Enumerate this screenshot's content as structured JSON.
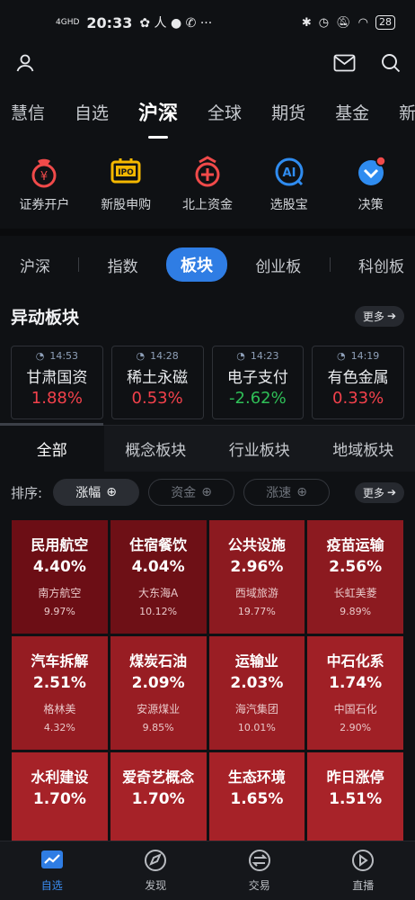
{
  "status_bar": {
    "network": "4GHD",
    "time": "20:33",
    "battery": "28"
  },
  "main_tabs": [
    "慧信",
    "自选",
    "沪深",
    "全球",
    "期货",
    "基金",
    "新三板"
  ],
  "quick": [
    {
      "label": "证券开户",
      "icon": "account-open-icon"
    },
    {
      "label": "新股申购",
      "icon": "ipo-icon"
    },
    {
      "label": "北上资金",
      "icon": "northbound-icon"
    },
    {
      "label": "选股宝",
      "icon": "ai-picker-icon"
    },
    {
      "label": "决策",
      "icon": "decision-icon"
    }
  ],
  "segments": [
    "沪深",
    "指数",
    "板块",
    "创业板",
    "科创板"
  ],
  "abnormal": {
    "title": "异动板块",
    "more": "更多",
    "cards": [
      {
        "time": "14:53",
        "name": "甘肃国资",
        "pct": "1.88%",
        "dir": "up"
      },
      {
        "time": "14:28",
        "name": "稀土永磁",
        "pct": "0.53%",
        "dir": "up"
      },
      {
        "time": "14:23",
        "name": "电子支付",
        "pct": "-2.62%",
        "dir": "down"
      },
      {
        "time": "14:19",
        "name": "有色金属",
        "pct": "0.33%",
        "dir": "up"
      }
    ]
  },
  "sub_tabs": [
    "全部",
    "概念板块",
    "行业板块",
    "地域板块"
  ],
  "sort": {
    "label": "排序:",
    "options": [
      "涨幅",
      "资金",
      "涨速"
    ],
    "more": "更多"
  },
  "tiles": [
    {
      "name": "民用航空",
      "pct": "4.40%",
      "stock": "南方航空",
      "stock_pct": "9.97%",
      "color": "#6c0e15"
    },
    {
      "name": "住宿餐饮",
      "pct": "4.04%",
      "stock": "大东海A",
      "stock_pct": "10.12%",
      "color": "#6e1016"
    },
    {
      "name": "公共设施",
      "pct": "2.96%",
      "stock": "西域旅游",
      "stock_pct": "19.77%",
      "color": "#8c1a20"
    },
    {
      "name": "疫苗运输",
      "pct": "2.56%",
      "stock": "长虹美菱",
      "stock_pct": "9.89%",
      "color": "#8c1a20"
    },
    {
      "name": "汽车拆解",
      "pct": "2.51%",
      "stock": "格林美",
      "stock_pct": "4.32%",
      "color": "#951c22"
    },
    {
      "name": "煤炭石油",
      "pct": "2.09%",
      "stock": "安源煤业",
      "stock_pct": "9.85%",
      "color": "#981d23"
    },
    {
      "name": "运输业",
      "pct": "2.03%",
      "stock": "海汽集团",
      "stock_pct": "10.01%",
      "color": "#9a1e24"
    },
    {
      "name": "中石化系",
      "pct": "1.74%",
      "stock": "中国石化",
      "stock_pct": "2.90%",
      "color": "#a02026"
    },
    {
      "name": "水利建设",
      "pct": "1.70%",
      "stock": "",
      "stock_pct": "",
      "color": "#a62228"
    },
    {
      "name": "爱奇艺概念",
      "pct": "1.70%",
      "stock": "",
      "stock_pct": "",
      "color": "#a62228"
    },
    {
      "name": "生态环境",
      "pct": "1.65%",
      "stock": "",
      "stock_pct": "",
      "color": "#a62228"
    },
    {
      "name": "昨日涨停",
      "pct": "1.51%",
      "stock": "",
      "stock_pct": "",
      "color": "#a82329"
    }
  ],
  "bottom_nav": [
    {
      "label": "自选",
      "icon": "watchlist-icon"
    },
    {
      "label": "发现",
      "icon": "discover-icon"
    },
    {
      "label": "交易",
      "icon": "trade-icon"
    },
    {
      "label": "直播",
      "icon": "live-icon"
    }
  ]
}
